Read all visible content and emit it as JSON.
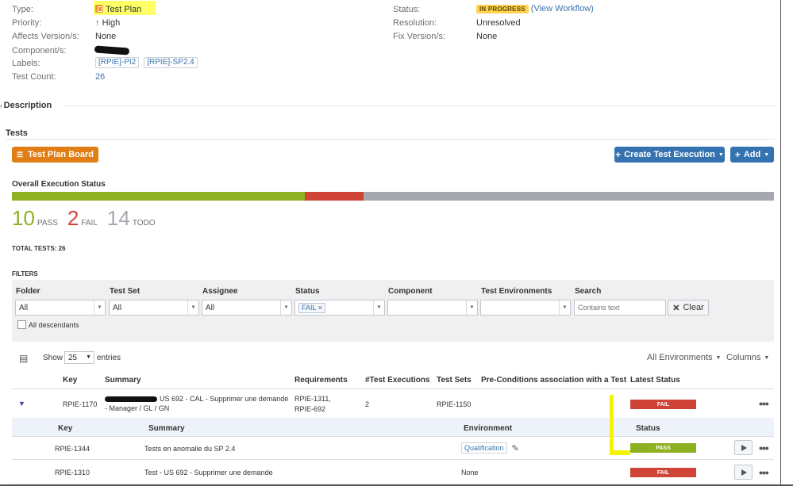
{
  "details": {
    "type_label": "Type:",
    "type_value": "Test Plan",
    "priority_label": "Priority:",
    "priority_value": "High",
    "affects_label": "Affects Version/s:",
    "affects_value": "None",
    "component_label": "Component/s:",
    "labels_label": "Labels:",
    "labels": [
      "[RPIE]-PI2",
      "[RPIE]-SP2.4"
    ],
    "test_count_label": "Test Count:",
    "test_count_value": "26",
    "status_label": "Status:",
    "status_value": "IN PROGRESS",
    "view_workflow": "(View Workflow)",
    "resolution_label": "Resolution:",
    "resolution_value": "Unresolved",
    "fix_label": "Fix Version/s:",
    "fix_value": "None"
  },
  "sections": {
    "description": "Description",
    "tests": "Tests"
  },
  "toolbar": {
    "test_plan_board": "Test Plan Board",
    "create_test_execution": "Create Test Execution",
    "add": "Add"
  },
  "execution": {
    "title": "Overall Execution Status",
    "pass_count": "10",
    "pass_label": "PASS",
    "fail_count": "2",
    "fail_label": "FAIL",
    "todo_count": "14",
    "todo_label": "TODO",
    "pass_fraction": 0.3846,
    "fail_fraction": 0.0769,
    "todo_fraction": 0.5385,
    "total_tests": "TOTAL TESTS: 26",
    "colors": {
      "pass": "#8eb021",
      "fail": "#d04437",
      "todo": "#a5a9ad"
    }
  },
  "filters": {
    "title": "FILTERS",
    "folder_label": "Folder",
    "folder_value": "All",
    "testset_label": "Test Set",
    "testset_value": "All",
    "assignee_label": "Assignee",
    "assignee_value": "All",
    "status_label": "Status",
    "status_chip": "FAIL",
    "component_label": "Component",
    "env_label": "Test Environments",
    "search_label": "Search",
    "search_placeholder": "Contains text",
    "clear_label": "Clear",
    "all_descendants": "All descendants"
  },
  "table": {
    "show_label": "Show",
    "show_value": "25",
    "entries_label": "entries",
    "all_environments": "All Environments",
    "columns": "Columns",
    "headers": {
      "key": "Key",
      "summary": "Summary",
      "requirements": "Requirements",
      "executions": "#Test Executions",
      "test_sets": "Test Sets",
      "preconditions": "Pre-Conditions association with a Test",
      "latest_status": "Latest Status"
    },
    "row": {
      "key": "RPIE-1170",
      "summary_line1": "US 692 - CAL - Supprimer une demande",
      "summary_line2": "- Manager / GL / GN",
      "requirements_line1": "RPIE-1311,",
      "requirements_line2": "RPIE-692",
      "executions": "2",
      "test_sets": "RPIE-1150",
      "latest_status": "FAIL"
    },
    "sub_headers": {
      "key": "Key",
      "summary": "Summary",
      "environment": "Environment",
      "status": "Status"
    },
    "sub_rows": [
      {
        "key": "RPIE-1344",
        "summary": "Tests en anomalie du SP 2.4",
        "environment": "Qualification",
        "status": "PASS"
      },
      {
        "key": "RPIE-1310",
        "summary": "Test - US 692 - Supprimer une demande",
        "environment": "None",
        "status": "FAIL"
      }
    ]
  }
}
